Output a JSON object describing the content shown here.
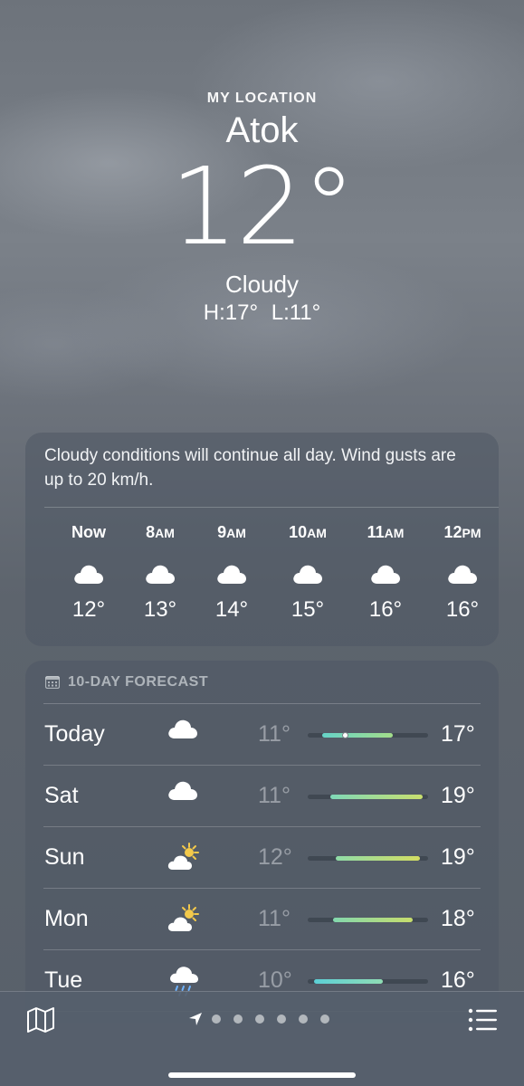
{
  "location": {
    "label": "MY LOCATION",
    "city": "Atok",
    "temperature": "12°",
    "condition": "Cloudy",
    "high": "H:17°",
    "low": "L:11°"
  },
  "hourly": {
    "summary": "Cloudy conditions will continue all day. Wind gusts are up to 20 km/h.",
    "items": [
      {
        "time": "Now",
        "suffix": "",
        "icon": "cloud-icon",
        "temp": "12°"
      },
      {
        "time": "8",
        "suffix": "AM",
        "icon": "cloud-icon",
        "temp": "13°"
      },
      {
        "time": "9",
        "suffix": "AM",
        "icon": "cloud-icon",
        "temp": "14°"
      },
      {
        "time": "10",
        "suffix": "AM",
        "icon": "cloud-icon",
        "temp": "15°"
      },
      {
        "time": "11",
        "suffix": "AM",
        "icon": "cloud-icon",
        "temp": "16°"
      },
      {
        "time": "12",
        "suffix": "PM",
        "icon": "cloud-icon",
        "temp": "16°"
      }
    ]
  },
  "forecast": {
    "title": "10-DAY FORECAST",
    "days": [
      {
        "day": "Today",
        "icon": "cloud-icon",
        "low": "11°",
        "high": "17°",
        "range_start": 0.12,
        "range_end": 0.71,
        "current": 0.31,
        "colors": [
          "#66d3c8",
          "#a3dd8a"
        ]
      },
      {
        "day": "Sat",
        "icon": "cloud-icon",
        "low": "11°",
        "high": "19°",
        "range_start": 0.19,
        "range_end": 0.96,
        "colors": [
          "#7fd9b8",
          "#c9df6e"
        ]
      },
      {
        "day": "Sun",
        "icon": "sun-cloud-icon",
        "low": "12°",
        "high": "19°",
        "range_start": 0.23,
        "range_end": 0.93,
        "colors": [
          "#8fdca8",
          "#d3dd62"
        ]
      },
      {
        "day": "Mon",
        "icon": "sun-cloud-icon",
        "low": "11°",
        "high": "18°",
        "range_start": 0.21,
        "range_end": 0.87,
        "colors": [
          "#83d8ae",
          "#c7dd6c"
        ]
      },
      {
        "day": "Tue",
        "icon": "rain-cloud-icon",
        "low": "10°",
        "high": "16°",
        "range_start": 0.05,
        "range_end": 0.62,
        "colors": [
          "#5ccfd6",
          "#8fdcb4"
        ]
      }
    ]
  },
  "bottom_bar": {
    "map_icon": "map-icon",
    "list_icon": "list-icon",
    "page_count": 6,
    "current_page": "location-arrow-icon"
  }
}
